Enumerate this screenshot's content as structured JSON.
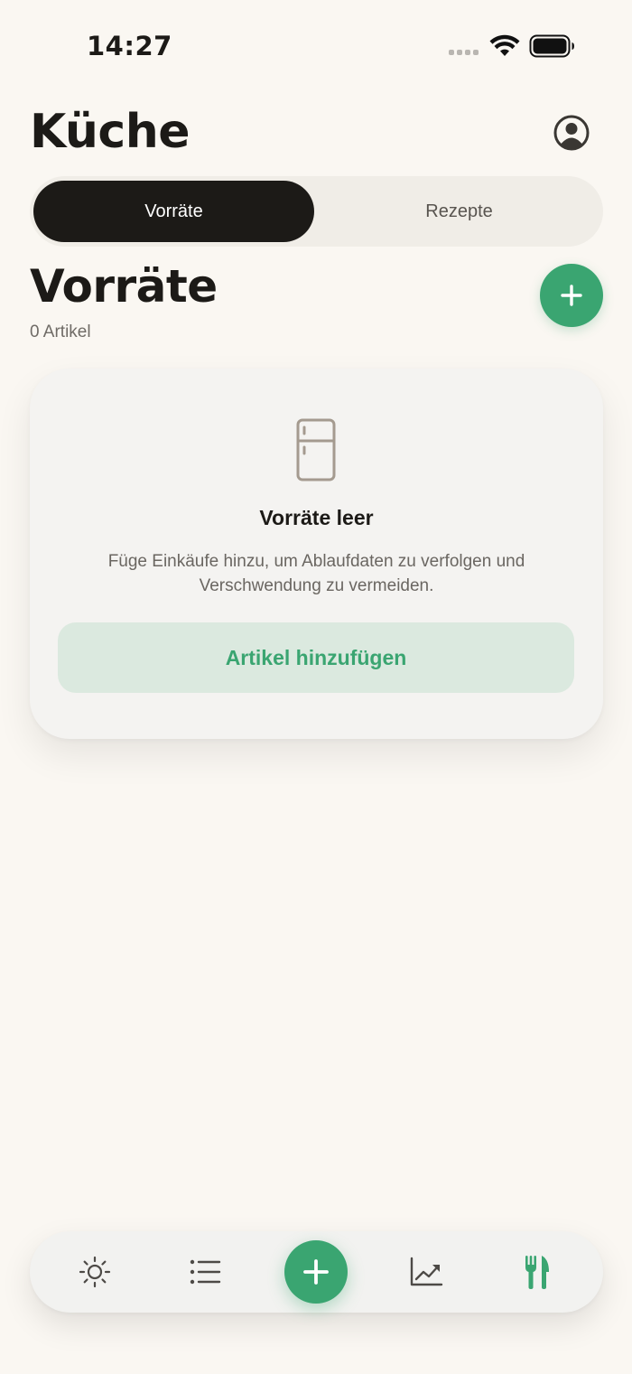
{
  "status_bar": {
    "time": "14:27"
  },
  "header": {
    "title": "Küche",
    "profile_icon": "person-circle-icon"
  },
  "segments": {
    "items": [
      {
        "label": "Vorräte",
        "active": true
      },
      {
        "label": "Rezepte",
        "active": false
      }
    ]
  },
  "section": {
    "title": "Vorräte",
    "count": "0 Artikel",
    "add_icon": "plus-icon"
  },
  "empty_state": {
    "icon": "fridge-icon",
    "title": "Vorräte leer",
    "line1": "Füge Einkäufe hinzu, um Ablaufdaten zu verfolgen und",
    "line2": "Verschwendung zu vermeiden.",
    "action_label": "Artikel hinzufügen"
  },
  "tab_bar": {
    "items": [
      {
        "icon": "sun-icon",
        "active": false
      },
      {
        "icon": "list-icon",
        "active": false
      },
      {
        "icon": "plus-icon",
        "active": false
      },
      {
        "icon": "chart-trend-icon",
        "active": false
      },
      {
        "icon": "fork-knife-icon",
        "active": true
      }
    ]
  },
  "colors": {
    "background": "#faf7f2",
    "accent": "#3aa571",
    "dark": "#1c1a17",
    "muted_text": "#6f6b66"
  }
}
